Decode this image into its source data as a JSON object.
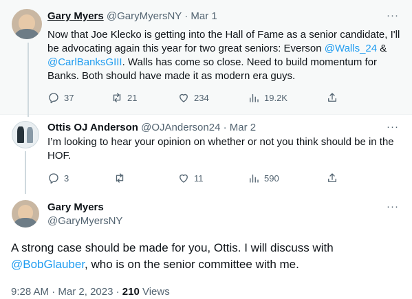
{
  "tweet1": {
    "name": "Gary Myers",
    "handle": "@GaryMyersNY",
    "sep": "·",
    "date": "Mar 1",
    "text_a": "Now that Joe Klecko is getting into the Hall of Fame as a senior candidate, I'll be advocating again this year for two great seniors: Everson ",
    "mention1": "@Walls_24",
    "text_b": " & ",
    "mention2": "@CarlBanksGIII",
    "text_c": ". Walls has come so close. Need to build momentum for Banks. Both should have made it as modern era guys.",
    "replies": "37",
    "retweets": "21",
    "likes": "234",
    "views": "19.2K",
    "more": "···"
  },
  "tweet2": {
    "name": "Ottis OJ Anderson",
    "handle": "@OJAnderson24",
    "sep": "·",
    "date": "Mar 2",
    "text": "I’m looking to hear your opinion on whether or not you think should be in the HOF.",
    "replies": "3",
    "retweets": "",
    "likes": "11",
    "views": "590",
    "more": "···"
  },
  "tweet3": {
    "name": "Gary Myers",
    "handle": "@GaryMyersNY",
    "text_a": "A strong case should be made for you, Ottis. I will discuss with ",
    "mention": "@BobGlauber",
    "text_b": ", who is on the senior committee with me.",
    "time": "9:28 AM",
    "sep1": "·",
    "date": "Mar 2, 2023",
    "sep2": "·",
    "views_count": "210",
    "views_label": "Views",
    "more": "···"
  },
  "icons": {
    "reply": "reply-icon",
    "retweet": "retweet-icon",
    "like": "like-icon",
    "views": "views-icon",
    "share": "share-icon",
    "more": "more-icon"
  },
  "colors": {
    "accent": "#1d9bf0",
    "text": "#0f1419",
    "muted": "#536471",
    "context_bg": "#f7f9f9",
    "thread_line": "#cfd9de"
  }
}
